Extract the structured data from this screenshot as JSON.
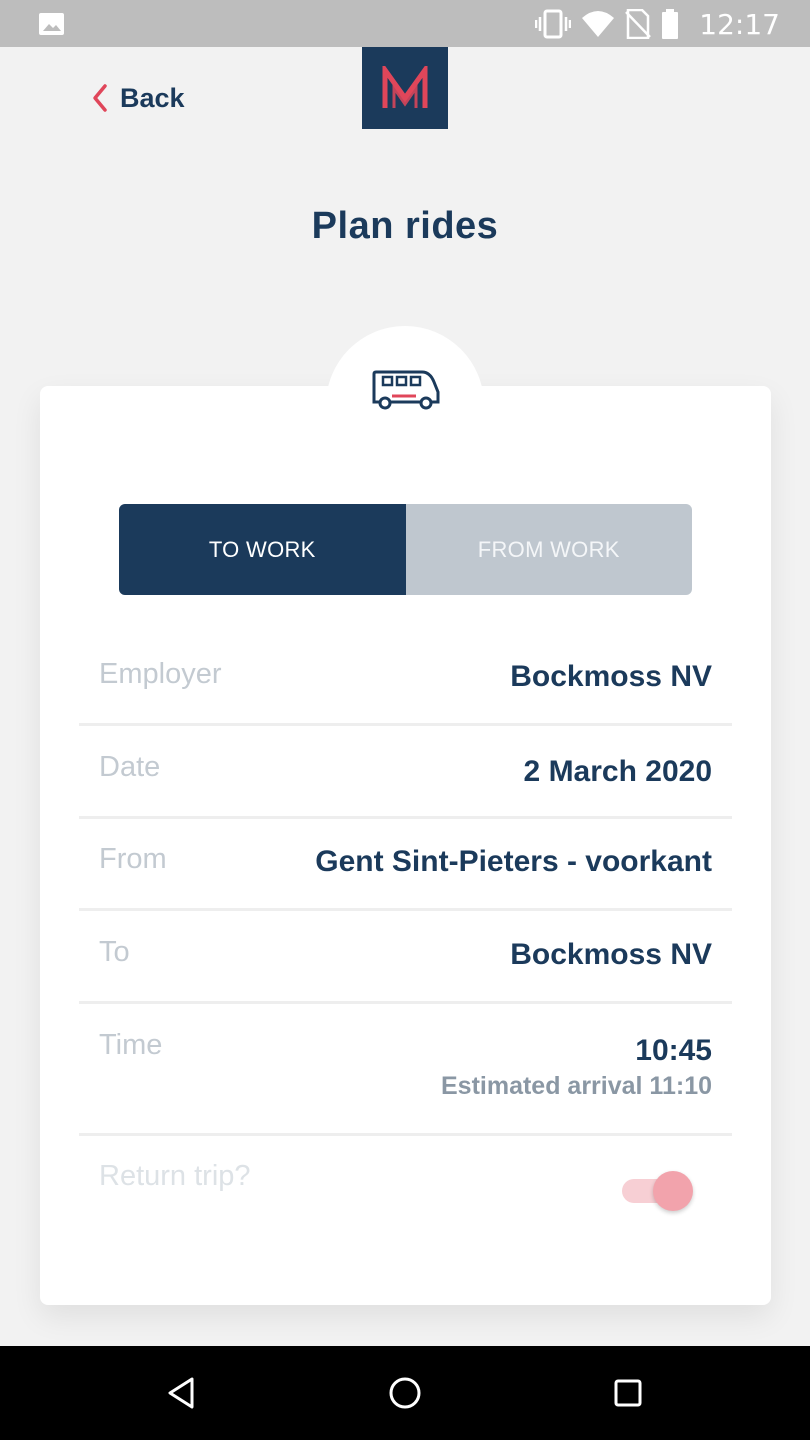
{
  "status_bar": {
    "time": "12:17",
    "icons": [
      "gallery-icon",
      "vibrate-icon",
      "wifi-icon",
      "no-sim-icon",
      "battery-icon"
    ]
  },
  "header": {
    "back_label": "Back",
    "logo_letter": "M",
    "title": "Plan rides"
  },
  "card": {
    "icon": "bus-icon",
    "tabs": [
      {
        "label": "TO WORK",
        "active": true
      },
      {
        "label": "FROM WORK",
        "active": false
      }
    ],
    "fields": [
      {
        "label": "Employer",
        "value": "Bockmoss NV"
      },
      {
        "label": "Date",
        "value": "2 March 2020"
      },
      {
        "label": "From",
        "value": "Gent Sint-Pieters - voorkant"
      },
      {
        "label": "To",
        "value": "Bockmoss NV"
      },
      {
        "label": "Time",
        "value": "10:45",
        "sub": "Estimated arrival 11:10"
      }
    ],
    "return_trip": {
      "label": "Return trip?",
      "enabled": true
    }
  },
  "colors": {
    "primary": "#1b3a5b",
    "accent": "#e0465a",
    "segment_inactive": "#bfc7cf",
    "toggle": "#f2a3ac"
  },
  "nav_bar": {
    "buttons": [
      "back-triangle-icon",
      "home-circle-icon",
      "recents-square-icon"
    ]
  }
}
